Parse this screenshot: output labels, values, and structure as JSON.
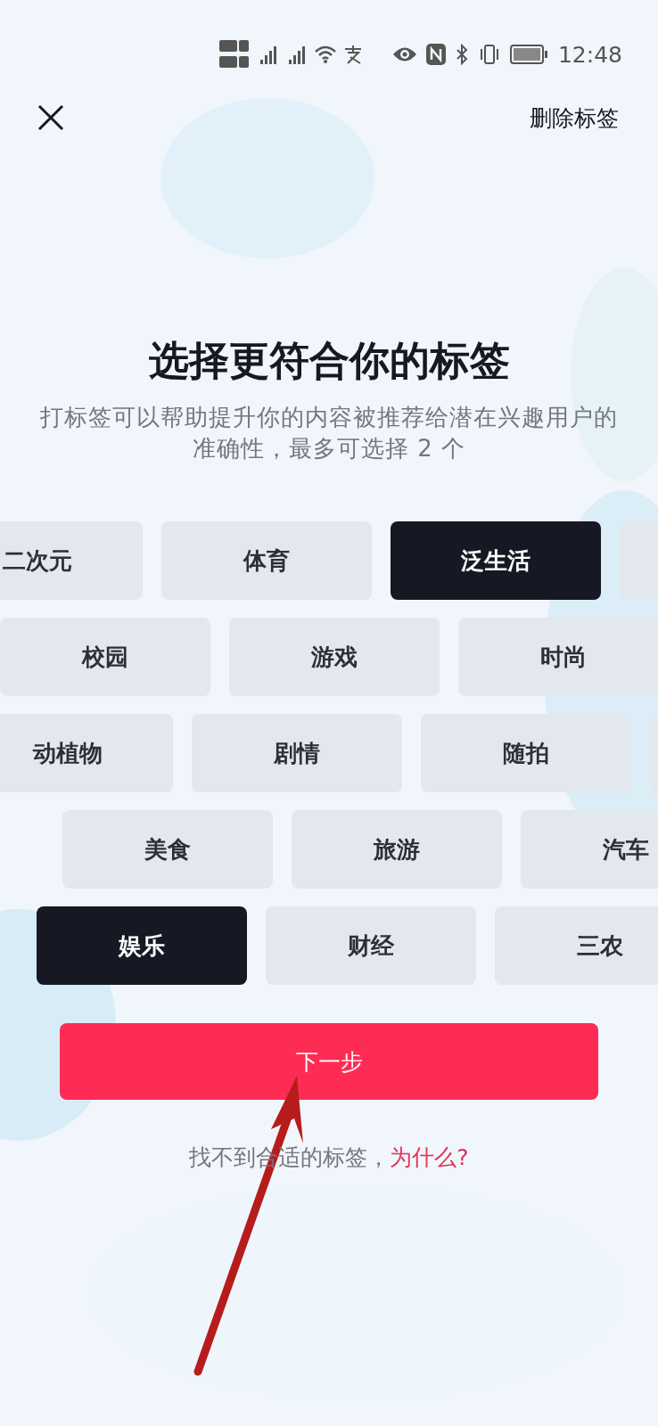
{
  "status_bar": {
    "time": "12:48"
  },
  "header": {
    "action": "删除标签"
  },
  "title": "选择更符合你的标签",
  "subtitle": "打标签可以帮助提升你的内容被推荐给潜在兴趣用户的准确性，最多可选择 2 个",
  "tag_rows": [
    [
      {
        "label": "二次元",
        "selected": false
      },
      {
        "label": "体育",
        "selected": false
      },
      {
        "label": "泛生活",
        "selected": true
      },
      {
        "selected": false
      }
    ],
    [
      {
        "label": "校园",
        "selected": false
      },
      {
        "label": "游戏",
        "selected": false
      },
      {
        "label": "时尚",
        "selected": false
      }
    ],
    [
      {
        "label": "动植物",
        "selected": false
      },
      {
        "label": "剧情",
        "selected": false
      },
      {
        "label": "随拍",
        "selected": false
      },
      {
        "selected": false
      }
    ],
    [
      {
        "label": "美食",
        "selected": false
      },
      {
        "label": "旅游",
        "selected": false
      },
      {
        "label": "汽车",
        "selected": false
      }
    ],
    [
      {
        "label": "娱乐",
        "selected": true
      },
      {
        "label": "财经",
        "selected": false
      },
      {
        "label": "三农",
        "selected": false
      }
    ]
  ],
  "next_button": "下一步",
  "footer": {
    "text": "找不到合适的标签，",
    "link": "为什么?"
  }
}
